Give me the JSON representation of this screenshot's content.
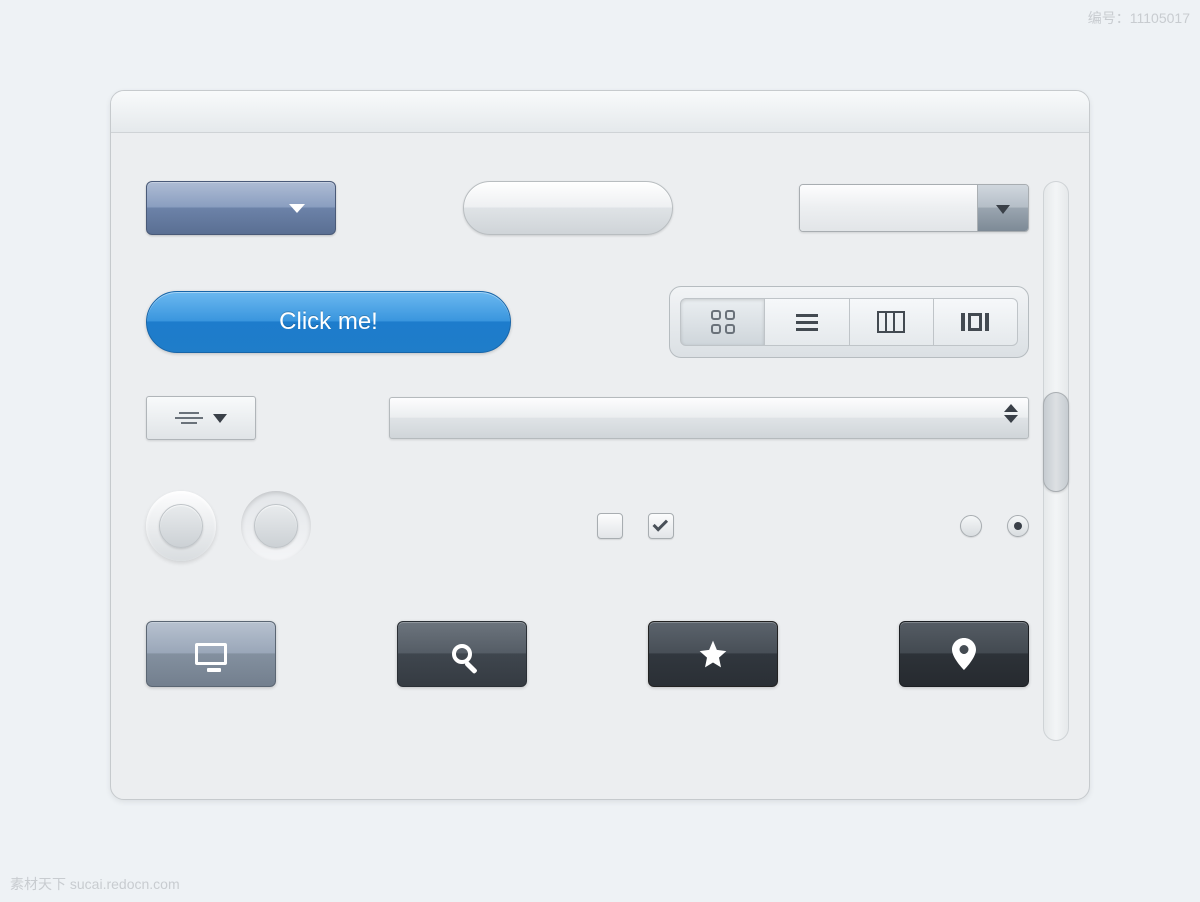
{
  "watermark": {
    "left": "素材天下 sucai.redocn.com",
    "right_label": "编号：",
    "right_value": "11105017"
  },
  "buttons": {
    "click_me": "Click me!"
  },
  "icons": {
    "dropdown_blue": "chevron-down-icon",
    "combo_trigger": "chevron-down-icon",
    "seg_grid": "grid-icon",
    "seg_list": "list-icon",
    "seg_columns": "columns-icon",
    "seg_carousel": "carousel-icon",
    "small_combo": "align-center-icon",
    "stepper": "stepper-icon",
    "monitor": "monitor-icon",
    "search": "search-icon",
    "star": "star-icon",
    "pin": "map-pin-icon"
  }
}
